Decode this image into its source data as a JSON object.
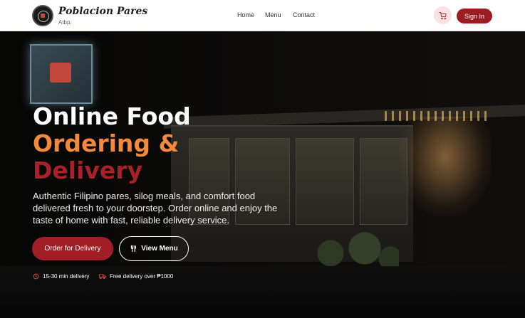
{
  "brand": {
    "name": "Poblacion Pares",
    "tagline": "Atbp."
  },
  "nav": {
    "links": [
      {
        "label": "Home"
      },
      {
        "label": "Menu"
      },
      {
        "label": "Contact"
      }
    ],
    "cart_icon": "shopping-cart-icon",
    "signin_label": "Sign In"
  },
  "hero": {
    "headline": [
      "Online Food",
      "Ordering &",
      "Delivery"
    ],
    "description": "Authentic Filipino pares, silog meals, and comfort food delivered fresh to your doorstep. Order online and enjoy the taste of home with fast, reliable delivery service.",
    "primary_cta": "Order for Delivery",
    "secondary_cta": "View Menu",
    "secondary_icon": "utensils-icon",
    "features": [
      {
        "icon": "clock-icon",
        "text": "15-30 min delivery"
      },
      {
        "icon": "truck-icon",
        "text": "Free delivery over ₱1000"
      }
    ]
  },
  "colors": {
    "brand_red": "#9b1d22",
    "accent_orange": "#f2893b",
    "headline_red": "#a82028",
    "cart_bg": "#fbe1e1"
  }
}
